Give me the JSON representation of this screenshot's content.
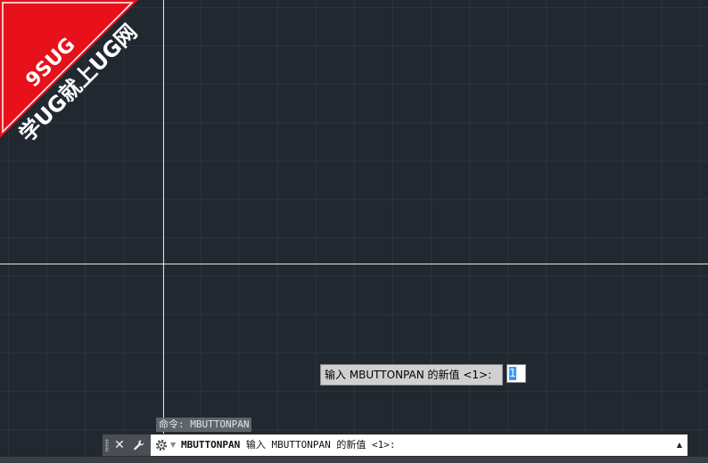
{
  "watermark": {
    "line1": "9SUG",
    "line2": "学UG就上UG网",
    "color": "#e8101a"
  },
  "dynamic_input": {
    "prompt": "输入 MBUTTONPAN 的新值 <1>:",
    "value": "1"
  },
  "command_history": {
    "text": "命令: MBUTTONPAN"
  },
  "command_line": {
    "close_icon": "close-icon",
    "customize_icon": "wrench-icon",
    "recent_icon": "gear-icon",
    "command_name": "MBUTTONPAN",
    "prompt": " 输入 MBUTTONPAN 的新值 <1>:",
    "history_toggle_icon": "triangle-up-icon"
  },
  "colors": {
    "canvas_background": "#212830",
    "grid_line": "#2c343d",
    "crosshair": "#e6e6e6",
    "selection_highlight": "#3399ff"
  }
}
